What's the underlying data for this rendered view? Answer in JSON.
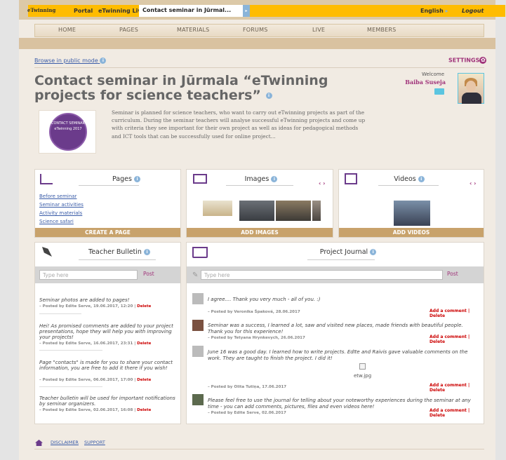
{
  "topbar": {
    "logo": "eTwinning",
    "portal": "Portal",
    "live": "eTwinning Live",
    "active_tab": "Contact seminar in Jūrmal...",
    "language": "English",
    "logout": "Logout"
  },
  "nav": [
    "HOME",
    "PAGES",
    "MATERIALS",
    "FORUMS",
    "LIVE",
    "MEMBERS"
  ],
  "browse_link": "Browse in public mode",
  "settings": "SETTINGS",
  "title": "Contact seminar in Jūrmala “eTwinning projects for science teachers”",
  "welcome": "Welcome",
  "username": "Baiba Suseja",
  "logo_text": "CONTACT SEMINAR eTwinning 2017",
  "description": "Seminar is planned for science teachers, who want to carry out eTwinning projects as part of the curriculum. During the seminar teachers will analyse successful eTwinning projects and come up with criteria they see important for their own project as well as ideas for pedagogical methods and ICT tools that can be successfully used for online project...",
  "pages_card": {
    "title": "Pages",
    "links": [
      "Before seminar",
      "Seminar activities",
      "Activity materials",
      "Science safari"
    ],
    "button": "CREATE A PAGE"
  },
  "images_card": {
    "title": "Images",
    "button": "ADD IMAGES"
  },
  "videos_card": {
    "title": "Videos",
    "button": "ADD VIDEOS"
  },
  "bulletin": {
    "title": "Teacher Bulletin",
    "placeholder": "Type here",
    "post": "Post",
    "items": [
      {
        "text": "Seminar photos are added to pages!",
        "by": "– Posted by Edite Serve, 19.06.2017, 12:20 |",
        "del": "Delete"
      },
      {
        "text": "Hei! As promised comments are added to your project presentations, hope they will help you with improving your projects!",
        "by": "– Posted by Edite Serve, 16.06.2017, 23:31 |",
        "del": "Delete"
      },
      {
        "text": "Page \"contacts\" is made for you to share your contact information, you are free to add it there if you wish!",
        "by": "– Posted by Edite Serve, 06.06.2017, 17:00 |",
        "del": "Delete"
      },
      {
        "text": "Teacher bulletin will be used for important notifications by seminar organizers.",
        "by": "– Posted by Edite Serve, 02.06.2017, 16:08 |",
        "del": "Delete"
      }
    ]
  },
  "journal": {
    "title": "Project Journal",
    "placeholder": "Type here",
    "post": "Post",
    "actions": "Add a comment | Delete",
    "items": [
      {
        "text": "I agree.... Thank you very much - all of you. :)",
        "by": "– Posted by Veronika Špaková, 28.06.2017"
      },
      {
        "text": "Seminar was a success, I learned a lot, saw and visited new places, made friends with beautiful people. Thank you for this experience!",
        "by": "– Posted by Tetyana Hrynkevych, 26.06.2017"
      },
      {
        "text": "June 16 was a good day. I learned how to write projects. Edīte and Raivis gave valuable comments on the work. They are taught to finish the project. I did it!",
        "by": "– Posted by Olita Tutiņa, 17.06.2017",
        "image": "etw.jpg"
      },
      {
        "text": "Please feel free to use the journal for telling about your noteworthy experiences during the seminar at any time - you can add comments, pictures, files and even videos here!",
        "by": "– Posted by Edite Serve, 02.06.2017"
      }
    ]
  },
  "footer": {
    "disclaimer": "DISCLAIMER",
    "support": "SUPPORT"
  }
}
